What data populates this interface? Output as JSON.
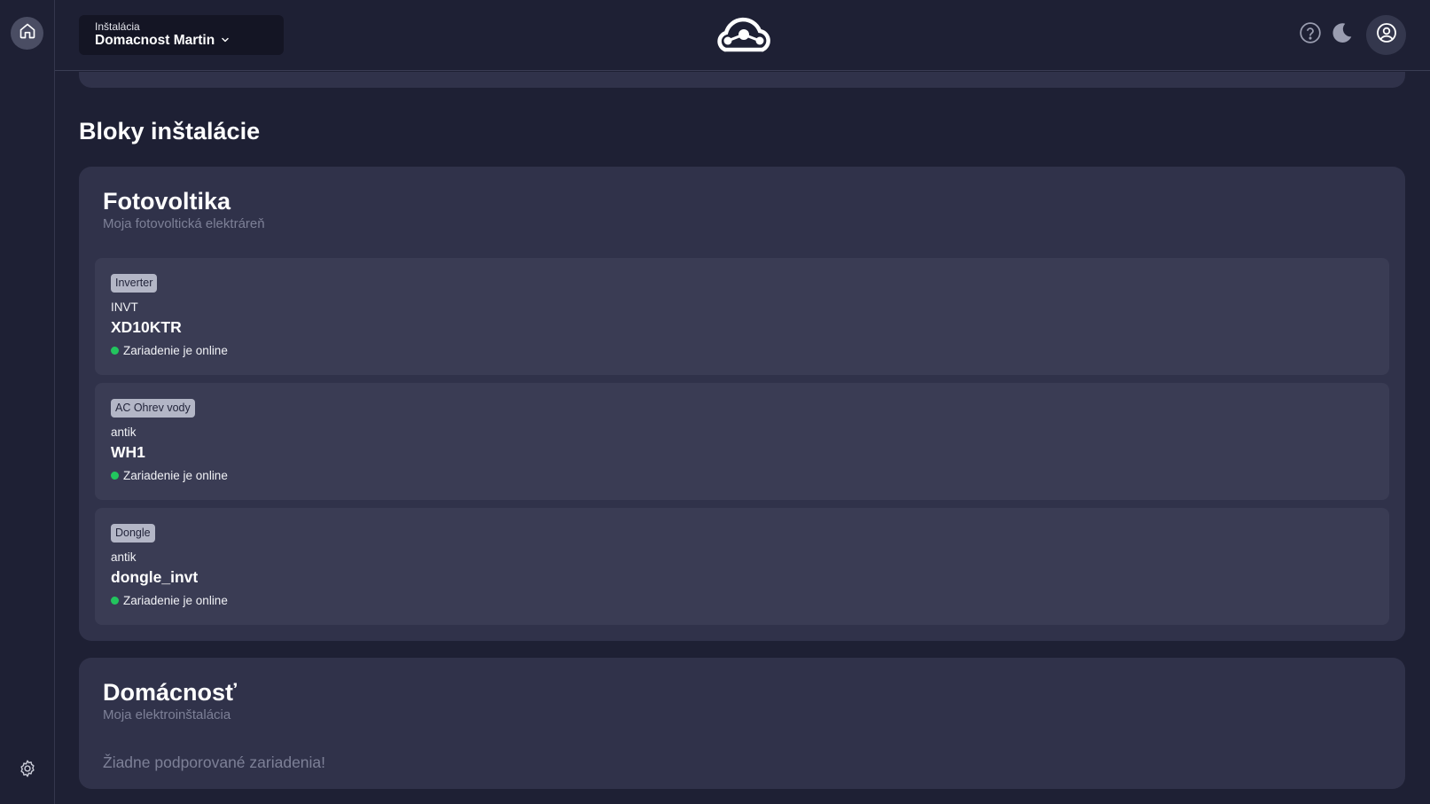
{
  "header": {
    "installation_label": "Inštalácia",
    "installation_value": "Domacnost Martin"
  },
  "icons": {
    "home": "home-icon",
    "settings": "gear-icon",
    "logo": "cloud-logo",
    "help": "help-circle-icon",
    "theme": "moon-icon",
    "user": "user-circle-icon",
    "dropdown": "chevron-down-icon"
  },
  "colors": {
    "background": "#1e2034",
    "card": "#30324a",
    "device_card": "#3a3c54",
    "online": "#22c55e",
    "badge": "#b3b6c6"
  },
  "main": {
    "section_title": "Bloky inštalácie",
    "blocks": [
      {
        "title": "Fotovoltika",
        "subtitle": "Moja fotovoltická elektráreň",
        "devices": [
          {
            "type": "Inverter",
            "brand": "INVT",
            "name": "XD10KTR",
            "status": "Zariadenie je online"
          },
          {
            "type": "AC Ohrev vody",
            "brand": "antik",
            "name": "WH1",
            "status": "Zariadenie je online"
          },
          {
            "type": "Dongle",
            "brand": "antik",
            "name": "dongle_invt",
            "status": "Zariadenie je online"
          }
        ]
      },
      {
        "title": "Domácnosť",
        "subtitle": "Moja elektroinštalácia",
        "empty_message": "Žiadne podporované zariadenia!"
      }
    ]
  }
}
